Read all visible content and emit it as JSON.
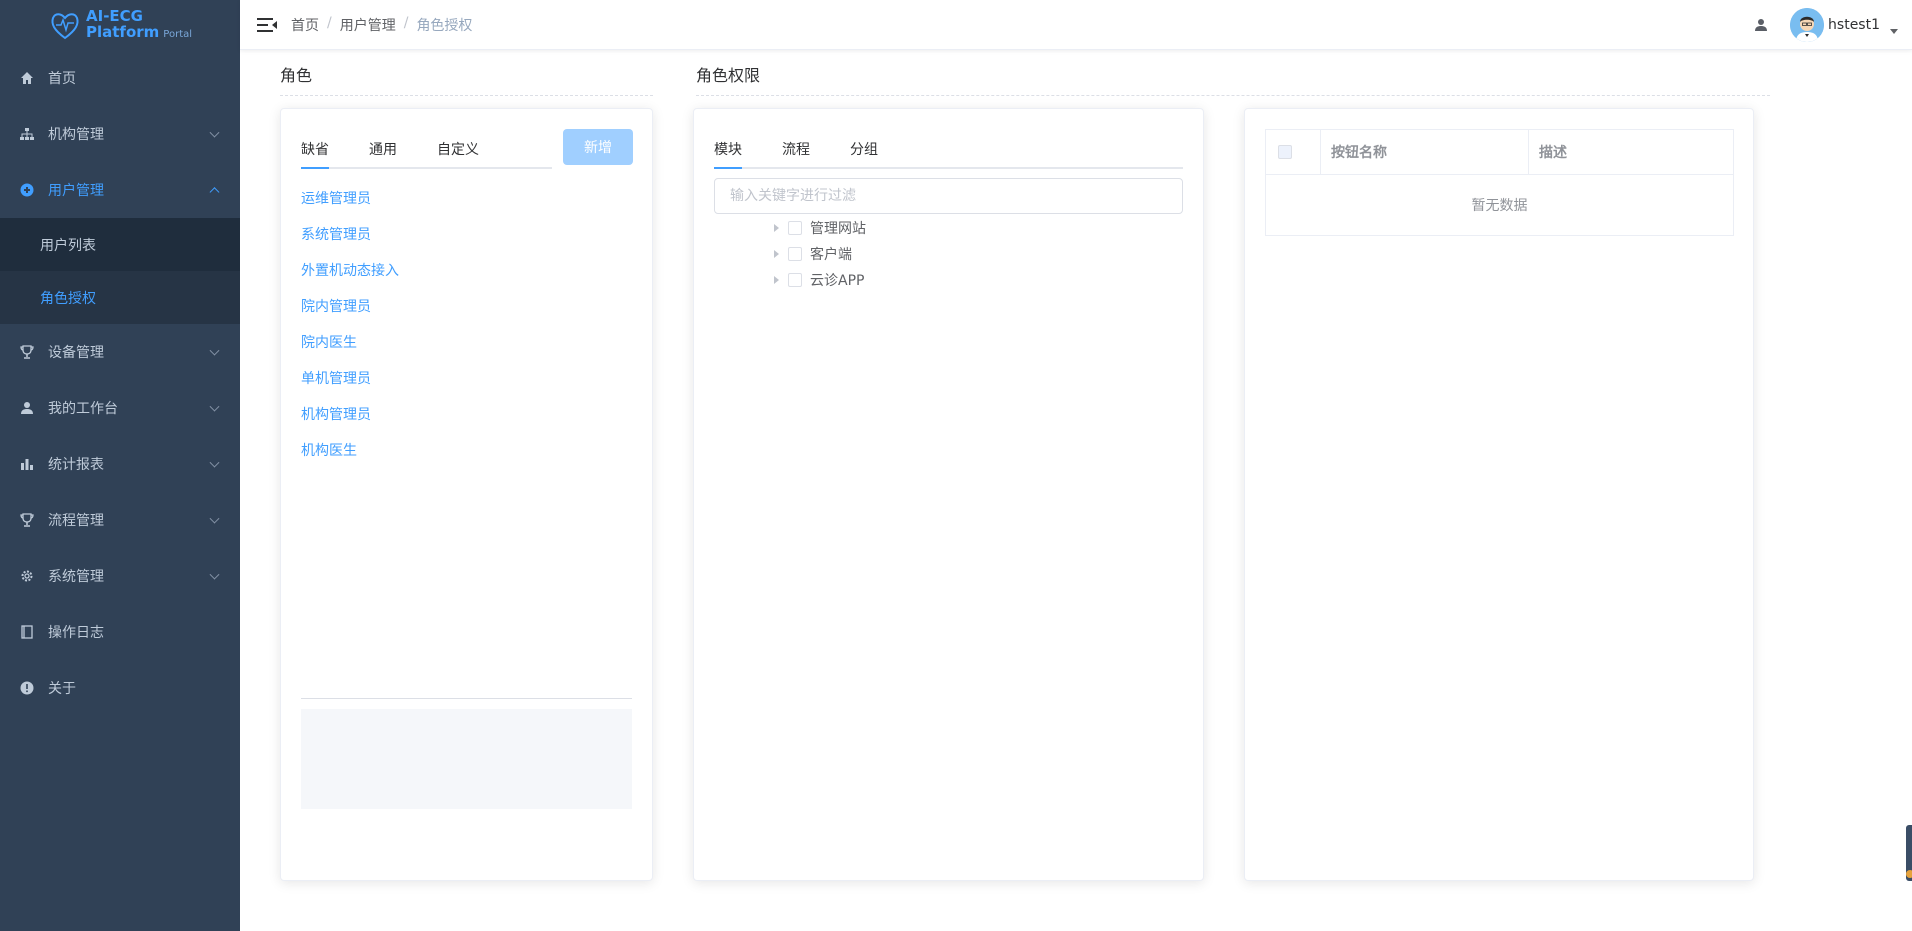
{
  "logo": {
    "line1": "AI-ECG",
    "line2": "Platform",
    "line2_sub": "Portal"
  },
  "sidebar": {
    "items": [
      {
        "label": "首页",
        "icon": "home-icon"
      },
      {
        "label": "机构管理",
        "icon": "org-tree-icon"
      },
      {
        "label": "用户管理",
        "icon": "user-manage-icon"
      },
      {
        "label": "设备管理",
        "icon": "trophy-icon"
      },
      {
        "label": "我的工作台",
        "icon": "person-icon"
      },
      {
        "label": "统计报表",
        "icon": "bar-chart-icon"
      },
      {
        "label": "流程管理",
        "icon": "trophy-icon"
      },
      {
        "label": "系统管理",
        "icon": "gear-icon"
      },
      {
        "label": "操作日志",
        "icon": "notebook-icon"
      },
      {
        "label": "关于",
        "icon": "info-icon"
      }
    ],
    "submenu": [
      {
        "label": "用户列表"
      },
      {
        "label": "角色授权"
      }
    ]
  },
  "header": {
    "breadcrumb": [
      "首页",
      "用户管理",
      "角色授权"
    ],
    "separator": "/",
    "username": "hstest1"
  },
  "roles_panel": {
    "title": "角色",
    "tabs": [
      "缺省",
      "通用",
      "自定义"
    ],
    "new_button": "新增",
    "roles": [
      "运维管理员",
      "系统管理员",
      "外置机动态接入",
      "院内管理员",
      "院内医生",
      "单机管理员",
      "机构管理员",
      "机构医生"
    ]
  },
  "permission_panel": {
    "title": "角色权限",
    "tabs": [
      "模块",
      "流程",
      "分组"
    ],
    "filter_placeholder": "输入关键字进行过滤",
    "tree": [
      "管理网站",
      "客户端",
      "云诊APP"
    ]
  },
  "button_table": {
    "columns": [
      "按钮名称",
      "描述"
    ],
    "empty_text": "暂无数据"
  },
  "colors": {
    "sidebar_bg": "#304156",
    "submenu_bg": "#1f2d3d",
    "accent": "#409eff",
    "new_button_bg": "#a0cfff"
  }
}
